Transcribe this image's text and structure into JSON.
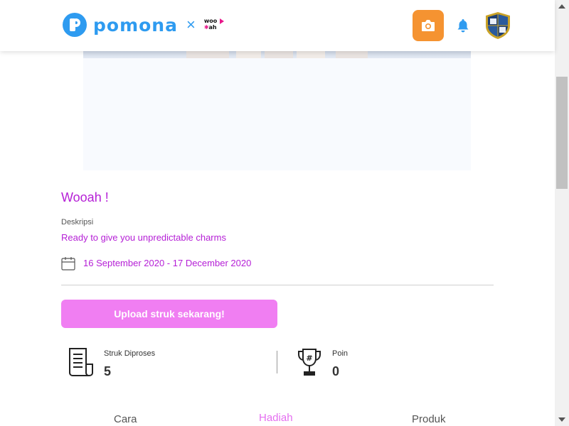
{
  "header": {
    "brand_name": "pomona",
    "collab_symbol": "×",
    "partner_logo_top": "woo",
    "partner_logo_bottom": "ah"
  },
  "campaign": {
    "title": "Wooah !",
    "description_label": "Deskripsi",
    "description": "Ready to give you unpredictable charms",
    "date_range": "16 September 2020 - 17 December 2020",
    "upload_button": "Upload struk sekarang!"
  },
  "stats": {
    "receipts_label": "Struk Diproses",
    "receipts_value": "5",
    "points_label": "Poin",
    "points_value": "0"
  },
  "tabs": [
    {
      "label": "Cara",
      "active": false
    },
    {
      "label": "Hadiah",
      "active": true
    },
    {
      "label": "Produk",
      "active": false
    }
  ],
  "icons": {
    "brand": "pomona-logo-icon",
    "camera": "camera-icon",
    "notification": "bell-icon",
    "profile": "shield-avatar-icon",
    "calendar": "calendar-icon",
    "receipt": "receipt-icon",
    "trophy": "trophy-icon"
  },
  "colors": {
    "brand_blue": "#2e9bf0",
    "accent_purple": "#b51fd6",
    "button_pink": "#f07ef2",
    "camera_orange": "#f59331",
    "active_tab": "#e46ef0"
  }
}
